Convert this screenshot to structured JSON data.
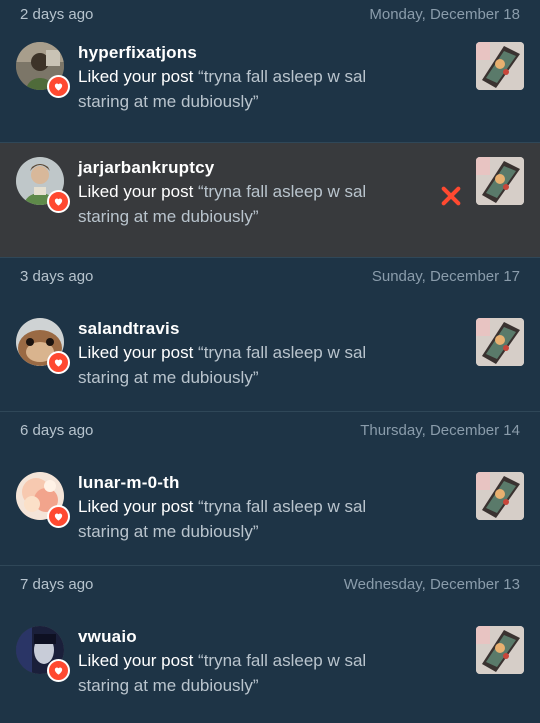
{
  "colors": {
    "background": "#1e3446",
    "hover_background": "#383a3d",
    "heart_badge": "#ff4930",
    "dismiss_x": "#ff4930",
    "date_text": "#8ea0ae",
    "quote_text": "#b9c4cd"
  },
  "groups": [
    {
      "relative_date": "2 days ago",
      "absolute_date": "Monday, December 18",
      "items": [
        {
          "username": "hyperfixatjons",
          "action": "Liked your post",
          "quote": "“tryna fall asleep w sal staring at me dubiously”",
          "avatar_icon": "avatar-photo-icon",
          "badge_icon": "heart-icon"
        },
        {
          "username": "jarjarbankruptcy",
          "action": "Liked your post",
          "quote": "“tryna fall asleep w sal staring at me dubiously”",
          "avatar_icon": "avatar-photo-icon",
          "badge_icon": "heart-icon",
          "hovered": true,
          "dismiss_icon": "close-icon"
        }
      ]
    },
    {
      "relative_date": "3 days ago",
      "absolute_date": "Sunday, December 17",
      "items": [
        {
          "username": "salandtravis",
          "action": "Liked your post",
          "quote": "“tryna fall asleep w sal staring at me dubiously”",
          "avatar_icon": "avatar-photo-icon",
          "badge_icon": "heart-icon"
        }
      ]
    },
    {
      "relative_date": "6 days ago",
      "absolute_date": "Thursday, December 14",
      "items": [
        {
          "username": "lunar-m-0-th",
          "action": "Liked your post",
          "quote": "“tryna fall asleep w sal staring at me dubiously”",
          "avatar_icon": "avatar-photo-icon",
          "badge_icon": "heart-icon"
        }
      ]
    },
    {
      "relative_date": "7 days ago",
      "absolute_date": "Wednesday, December 13",
      "items": [
        {
          "username": "vwuaio",
          "action": "Liked your post",
          "quote": "“tryna fall asleep w sal staring at me dubiously”",
          "avatar_icon": "avatar-photo-icon",
          "badge_icon": "heart-icon"
        }
      ]
    }
  ]
}
